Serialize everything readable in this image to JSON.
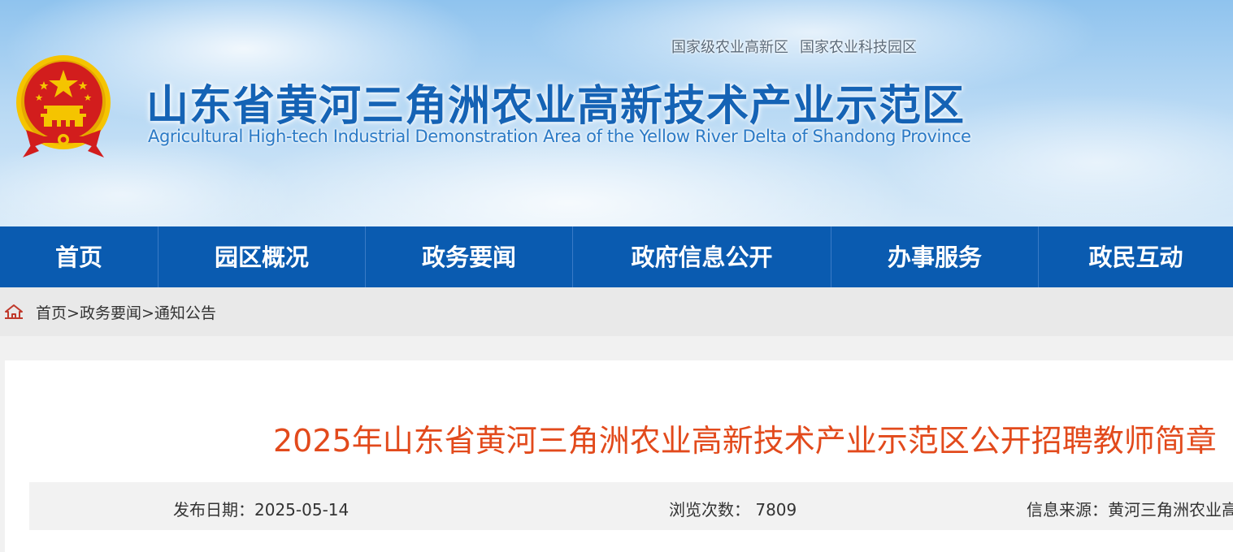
{
  "header": {
    "tags": [
      "国家级农业高新区",
      "国家农业科技园区"
    ],
    "title": "山东省黄河三角洲农业高新技术产业示范区",
    "subtitle": "Agricultural High-tech Industrial Demonstration Area of the Yellow River Delta of Shandong Province",
    "emblem_icon": "national-emblem-icon"
  },
  "nav": {
    "items": [
      {
        "label": "首页"
      },
      {
        "label": "园区概况"
      },
      {
        "label": "政务要闻"
      },
      {
        "label": "政府信息公开"
      },
      {
        "label": "办事服务"
      },
      {
        "label": "政民互动"
      }
    ]
  },
  "breadcrumb": {
    "icon": "home-icon",
    "items": [
      "首页",
      "政务要闻",
      "通知公告"
    ],
    "separator": ">"
  },
  "article": {
    "title": "2025年山东省黄河三角洲农业高新技术产业示范区公开招聘教师简章",
    "publish_label": "发布日期：",
    "publish_date": "2025-05-14",
    "views_label": "浏览次数：",
    "views": "7809",
    "source_label": "信息来源：",
    "source": "黄河三角洲农业高"
  },
  "colors": {
    "nav_bg": "#0a5bb0",
    "title_blue": "#1563b5",
    "article_title": "#e24a1c",
    "emblem_red": "#d21d1d",
    "emblem_gold": "#f5c400"
  }
}
